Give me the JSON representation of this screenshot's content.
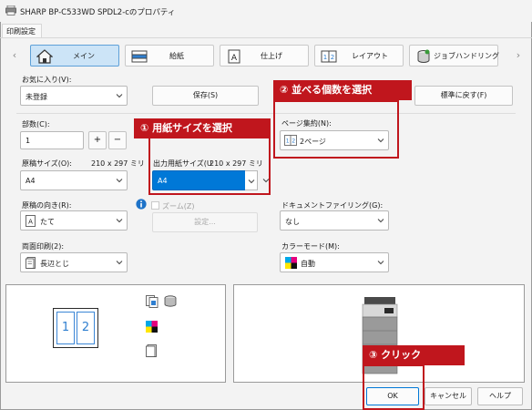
{
  "window": {
    "title": "SHARP BP-C533WD SPDL2-cのプロパティ"
  },
  "tabs": [
    {
      "label": "印刷設定"
    }
  ],
  "function_tabs": [
    {
      "label": "メイン",
      "icon": "home-icon"
    },
    {
      "label": "給紙",
      "icon": "paper-tray-icon"
    },
    {
      "label": "仕上げ",
      "icon": "finishing-icon"
    },
    {
      "label": "レイアウト",
      "icon": "layout-icon"
    },
    {
      "label": "ジョブハンドリング",
      "icon": "job-handling-icon"
    }
  ],
  "favorites": {
    "label": "お気に入り(V):",
    "value": "未登録",
    "save_label": "保存(S)",
    "reset_label": "標準に戻す(F)"
  },
  "copies": {
    "label": "部数(C):",
    "value": "1",
    "plus": "+",
    "minus": "−"
  },
  "original_size": {
    "label": "原稿サイズ(O):",
    "dims": "210 x 297 ミリ",
    "value": "A4"
  },
  "output_size": {
    "label": "出力用紙サイズ(U",
    "dims": "210 x 297 ミリ",
    "value": "A4"
  },
  "orientation": {
    "label": "原稿の向き(R):",
    "value": "たて"
  },
  "zoom": {
    "label": "ズーム(Z)",
    "settings_label": "設定..."
  },
  "duplex": {
    "label": "両面印刷(2):",
    "value": "長辺とじ"
  },
  "nup": {
    "label": "ページ集約(N):",
    "value": "2ページ"
  },
  "document_filing": {
    "label": "ドキュメントファイリング(G):",
    "value": "なし"
  },
  "color_mode": {
    "label": "カラーモード(M):",
    "value": "自動"
  },
  "preview": {
    "page1": "1",
    "page2": "2"
  },
  "buttons": {
    "ok": "OK",
    "cancel": "キャンセル",
    "help": "ヘルプ"
  },
  "callouts": [
    {
      "text": "① 用紙サイズを選択"
    },
    {
      "text": "② 並べる個数を選択"
    },
    {
      "text": "③ クリック"
    }
  ],
  "colors": {
    "accent": "#0078d7",
    "callout": "#c0161d",
    "active_tab": "#cce4f7"
  }
}
